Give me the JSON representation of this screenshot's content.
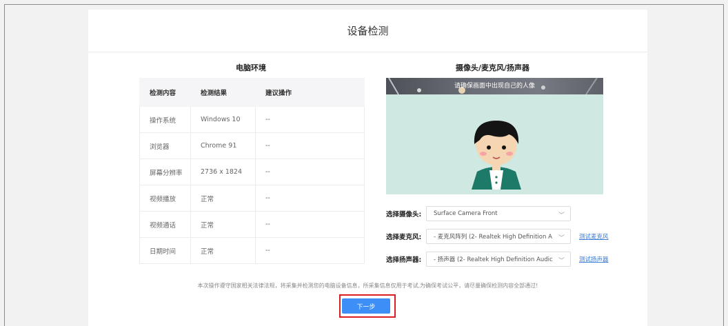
{
  "page": {
    "title": "设备检测"
  },
  "env": {
    "title": "电脑环境",
    "headers": [
      "检测内容",
      "检测结果",
      "建议操作"
    ],
    "rows": [
      [
        "操作系统",
        "Windows 10",
        "--"
      ],
      [
        "浏览器",
        "Chrome 91",
        "--"
      ],
      [
        "屏幕分辨率",
        "2736 x 1824",
        "--"
      ],
      [
        "视频播放",
        "正常",
        "--"
      ],
      [
        "视频通话",
        "正常",
        "--"
      ],
      [
        "日期时间",
        "正常",
        "--"
      ]
    ]
  },
  "devices": {
    "title": "摄像头/麦克风/扬声器",
    "camera_hint": "请确保画面中出现自己的人像",
    "camera_label": "选择摄像头:",
    "camera_value": "Surface Camera Front",
    "mic_label": "选择麦克风:",
    "mic_value": "- 麦克风阵列 (2- Realtek High Definition A",
    "mic_test": "测试麦克风",
    "speaker_label": "选择扬声器:",
    "speaker_value": "- 扬声器 (2- Realtek High Definition Audic",
    "speaker_test": "测试扬声器"
  },
  "notice": "本次操作遵守国家相关法律法规，将采集并检测您的电脑设备信息，所采集信息仅用于考试,为确保考试公平，请尽量确保检测内容全部通过!",
  "next_button": "下一步",
  "colors": {
    "accent": "#3e8ef7",
    "highlight": "#d81e1e",
    "camera_bg": "#cfe9e2"
  }
}
